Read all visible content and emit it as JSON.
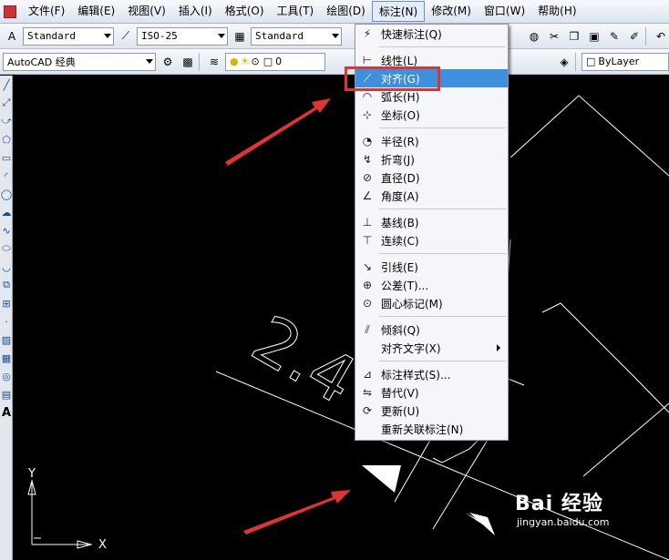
{
  "menubar": {
    "items": [
      "文件(F)",
      "编辑(E)",
      "视图(V)",
      "插入(I)",
      "格式(O)",
      "工具(T)",
      "绘图(D)",
      "标注(N)",
      "修改(M)",
      "窗口(W)",
      "帮助(H)"
    ],
    "active_index": 7
  },
  "toolbar1": {
    "text_style": "Standard",
    "dim_style": "ISO-25",
    "table_style": "Standard"
  },
  "toolbar2": {
    "workspace": "AutoCAD 经典",
    "layer_name": "0",
    "color": "ByLayer"
  },
  "dimension_menu": {
    "items": [
      {
        "label": "快速标注(Q)",
        "icon": "quick-dimension-icon"
      },
      {
        "separator": true
      },
      {
        "label": "线性(L)",
        "icon": "linear-dimension-icon"
      },
      {
        "label": "对齐(G)",
        "icon": "aligned-dimension-icon",
        "highlighted": true
      },
      {
        "label": "弧长(H)",
        "icon": "arc-length-icon"
      },
      {
        "label": "坐标(O)",
        "icon": "ordinate-icon"
      },
      {
        "separator": true
      },
      {
        "label": "半径(R)",
        "icon": "radius-icon"
      },
      {
        "label": "折弯(J)",
        "icon": "jogged-icon"
      },
      {
        "label": "直径(D)",
        "icon": "diameter-icon"
      },
      {
        "label": "角度(A)",
        "icon": "angular-icon"
      },
      {
        "separator": true
      },
      {
        "label": "基线(B)",
        "icon": "baseline-icon"
      },
      {
        "label": "连续(C)",
        "icon": "continue-icon"
      },
      {
        "separator": true
      },
      {
        "label": "引线(E)",
        "icon": "leader-icon"
      },
      {
        "label": "公差(T)...",
        "icon": "tolerance-icon"
      },
      {
        "label": "圆心标记(M)",
        "icon": "center-mark-icon"
      },
      {
        "separator": true
      },
      {
        "label": "倾斜(Q)",
        "icon": "oblique-icon"
      },
      {
        "label": "对齐文字(X)",
        "icon": "",
        "submenu": true
      },
      {
        "separator": true
      },
      {
        "label": "标注样式(S)...",
        "icon": "dimension-style-icon"
      },
      {
        "label": "替代(V)",
        "icon": "override-icon"
      },
      {
        "label": "更新(U)",
        "icon": "update-icon"
      },
      {
        "label": "重新关联标注(N)",
        "icon": ""
      }
    ]
  },
  "ucs": {
    "x_label": "X",
    "y_label": "Y"
  },
  "canvas_text": {
    "dimension_text": "2.4"
  },
  "watermark": {
    "brand": "Bai 经验",
    "url": "jingyan.baidu.com"
  },
  "colors": {
    "highlight": "#3f8fdf",
    "annotation_red": "#e33232",
    "canvas": "#000000"
  }
}
